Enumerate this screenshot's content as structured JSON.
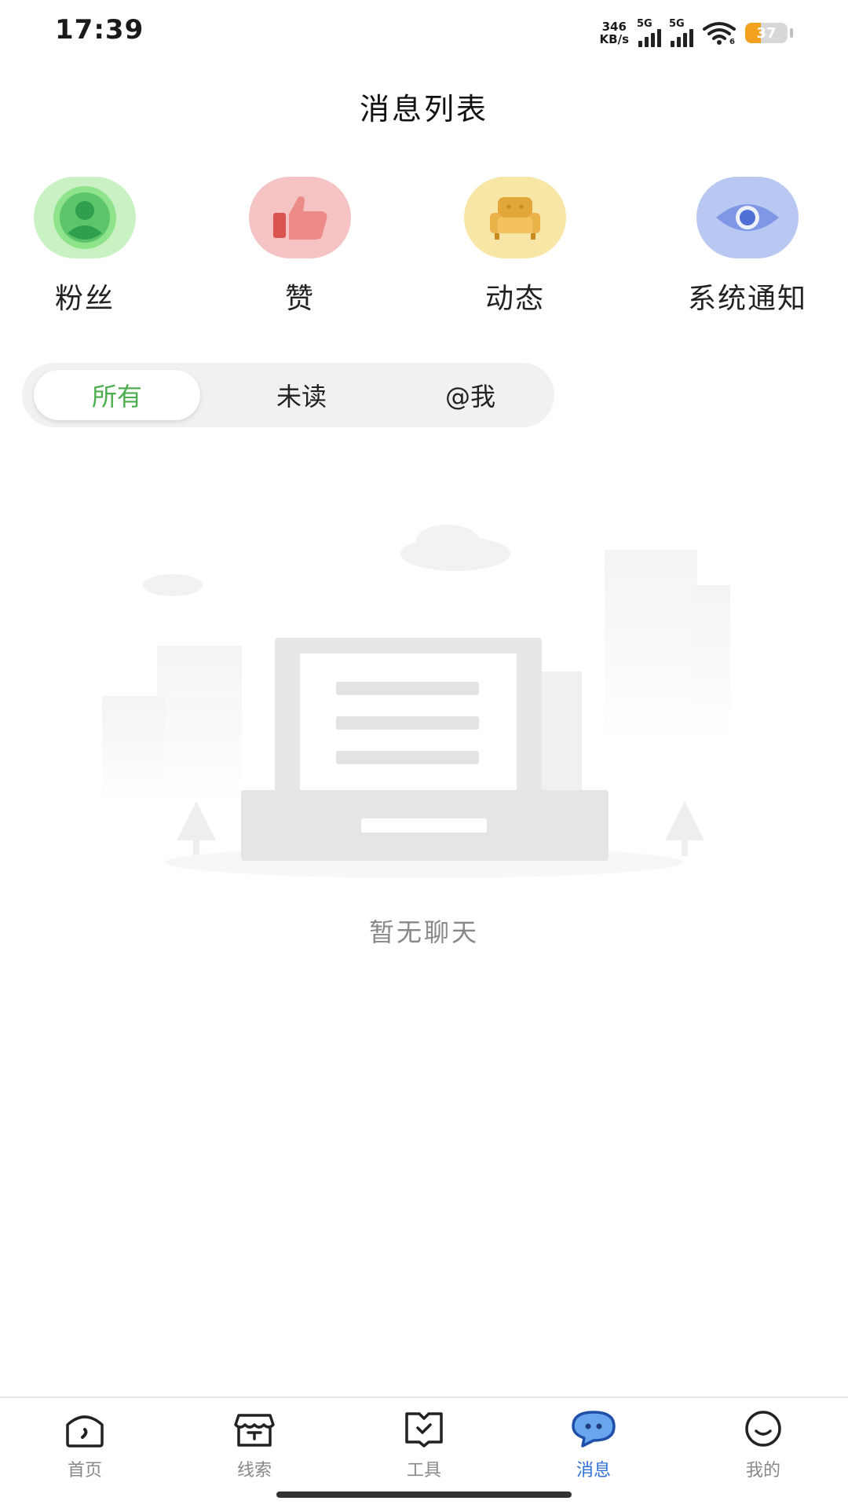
{
  "status_bar": {
    "time": "17:39",
    "net_speed_value": "346",
    "net_speed_unit": "KB/s",
    "sim1_tag": "5G",
    "sim2_tag": "5G",
    "battery_level": "37",
    "battery_color": "#f2a11f"
  },
  "header": {
    "title": "消息列表"
  },
  "categories": [
    {
      "label": "粉丝",
      "icon": "fans-icon",
      "color": "#c9f1c3"
    },
    {
      "label": "赞",
      "icon": "thumbs-up-icon",
      "color": "#f5c3c3"
    },
    {
      "label": "动态",
      "icon": "sofa-icon",
      "color": "#f8e6a6"
    },
    {
      "label": "系统通知",
      "icon": "eye-icon",
      "color": "#b9c8f3"
    }
  ],
  "tabs": [
    {
      "label": "所有",
      "active": true
    },
    {
      "label": "未读",
      "active": false
    },
    {
      "label": "@我",
      "active": false
    }
  ],
  "accent_color": "#4cae4c",
  "empty_state": {
    "text": "暂无聊天",
    "illustration": "empty-chat-illustration"
  },
  "bottom_nav": [
    {
      "label": "首页",
      "icon": "home-icon",
      "active": false
    },
    {
      "label": "线索",
      "icon": "store-icon",
      "active": false
    },
    {
      "label": "工具",
      "icon": "toolbox-icon",
      "active": false
    },
    {
      "label": "消息",
      "icon": "chat-bubble-icon",
      "active": true
    },
    {
      "label": "我的",
      "icon": "smiley-icon",
      "active": false
    }
  ],
  "nav_active_color": "#2f6fd6"
}
